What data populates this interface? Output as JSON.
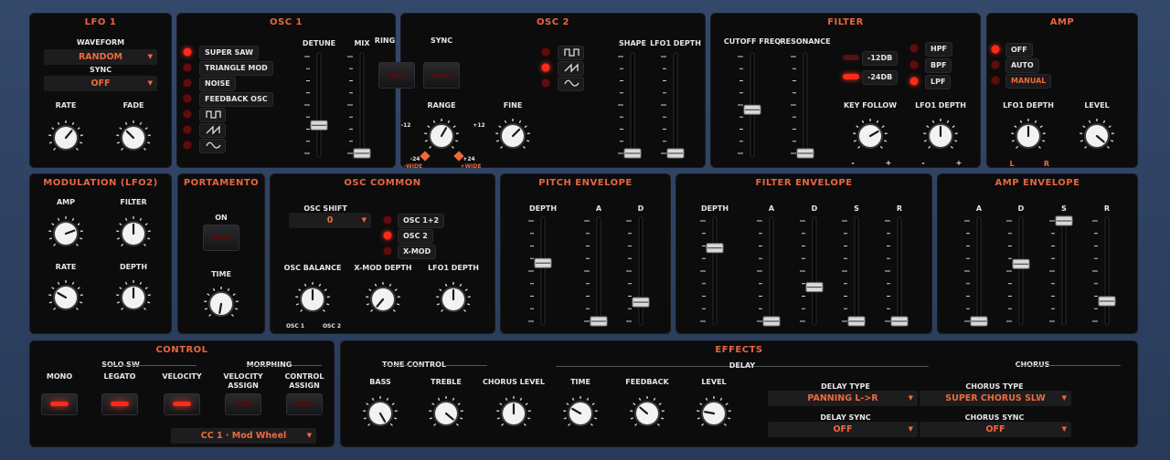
{
  "lfo1": {
    "title": "LFO 1",
    "waveform_label": "WAVEFORM",
    "waveform": "RANDOM",
    "sync_label": "SYNC",
    "sync": "OFF",
    "rate": "RATE",
    "fade": "FADE"
  },
  "osc1": {
    "title": "OSC 1",
    "waves": [
      "SUPER SAW",
      "TRIANGLE MOD",
      "NOISE",
      "FEEDBACK OSC"
    ],
    "detune": "DETUNE",
    "mix": "MIX",
    "ring": "RING",
    "sync": "SYNC",
    "range": "RANGE",
    "fine": "FINE",
    "r_m12": "-12",
    "r_p12": "+12",
    "r_m24": "-24",
    "r_p24": "+24",
    "wide_l": "-WIDE",
    "wide_r": "+WIDE"
  },
  "osc2": {
    "title": "OSC 2",
    "shape": "SHAPE",
    "lfo1_depth": "LFO1 DEPTH"
  },
  "filter": {
    "title": "FILTER",
    "cutoff": "CUTOFF FREQ",
    "resonance": "RESONANCE",
    "slope12": "-12DB",
    "slope24": "-24DB",
    "hpf": "HPF",
    "bpf": "BPF",
    "lpf": "LPF",
    "key_follow": "KEY FOLLOW",
    "lfo1_depth": "LFO1 DEPTH",
    "minus": "-",
    "plus": "+"
  },
  "amp": {
    "title": "AMP",
    "off": "OFF",
    "auto": "AUTO",
    "manual": "MANUAL",
    "lfo1_depth": "LFO1 DEPTH",
    "level": "LEVEL",
    "l": "L",
    "r": "R"
  },
  "mod": {
    "title": "MODULATION (LFO2)",
    "amp": "AMP",
    "filter": "FILTER",
    "rate": "RATE",
    "depth": "DEPTH"
  },
  "porta": {
    "title": "PORTAMENTO",
    "on": "ON",
    "time": "TIME"
  },
  "osccommon": {
    "title": "OSC COMMON",
    "shift_label": "OSC SHIFT",
    "shift": "0",
    "osc12": "OSC 1+2",
    "osc2": "OSC 2",
    "xmod": "X-MOD",
    "balance": "OSC BALANCE",
    "xmod_depth": "X-MOD DEPTH",
    "lfo1_depth": "LFO1 DEPTH",
    "bal_l": "OSC 1",
    "bal_r": "OSC 2"
  },
  "pitchenv": {
    "title": "PITCH ENVELOPE",
    "depth": "DEPTH",
    "a": "A",
    "d": "D"
  },
  "filterenv": {
    "title": "FILTER ENVELOPE",
    "depth": "DEPTH",
    "a": "A",
    "d": "D",
    "s": "S",
    "r": "R"
  },
  "ampenv": {
    "title": "AMP ENVELOPE",
    "a": "A",
    "d": "D",
    "s": "S",
    "r": "R"
  },
  "control": {
    "title": "CONTROL",
    "solo_sw": "SOLO SW",
    "morphing": "MORPHING",
    "mono": "MONO",
    "legato": "LEGATO",
    "velocity": "VELOCITY",
    "vel_assign_1": "VELOCITY",
    "vel_assign_2": "ASSIGN",
    "ctl_assign_1": "CONTROL",
    "ctl_assign_2": "ASSIGN",
    "cc": "CC 1 · Mod Wheel"
  },
  "effects": {
    "title": "EFFECTS",
    "tone": "TONE CONTROL",
    "delay": "DELAY",
    "chorus": "CHORUS",
    "bass": "BASS",
    "treble": "TREBLE",
    "chorus_level": "CHORUS LEVEL",
    "time": "TIME",
    "feedback": "FEEDBACK",
    "level": "LEVEL",
    "delay_type_label": "DELAY TYPE",
    "delay_type": "PANNING L->R",
    "chorus_type_label": "CHORUS TYPE",
    "chorus_type": "SUPER CHORUS SLW",
    "delay_sync_label": "DELAY SYNC",
    "delay_sync": "OFF",
    "chorus_sync_label": "CHORUS SYNC",
    "chorus_sync": "OFF"
  },
  "colors": {
    "accent": "#e8663d",
    "led_on": "#ff2a1a",
    "panel": "#0c0c0d",
    "background": "#2f4264"
  }
}
